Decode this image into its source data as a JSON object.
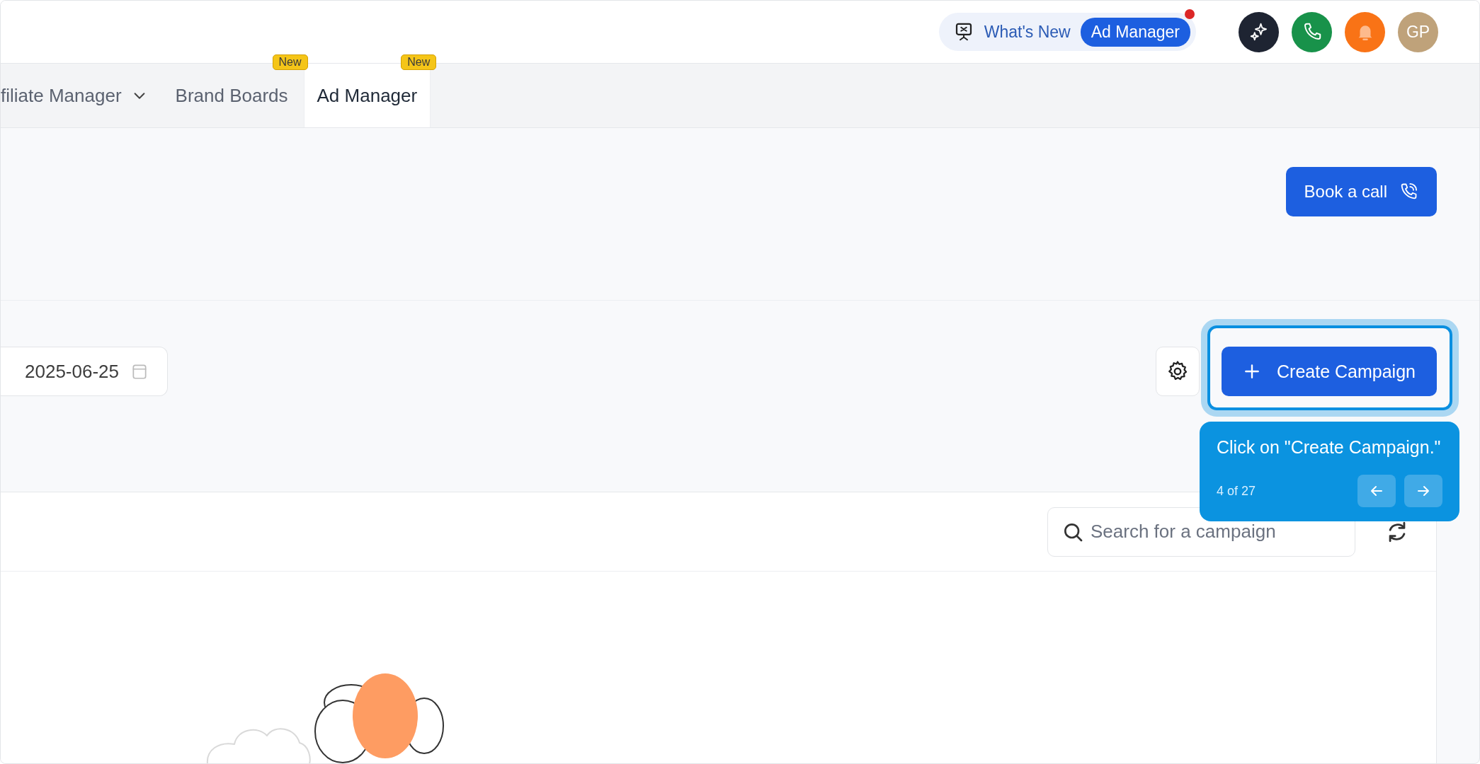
{
  "header": {
    "whats_new": {
      "label": "What's New"
    },
    "product_pill": {
      "label": "Ad Manager",
      "notification": true
    },
    "avatar": {
      "initials": "GP"
    }
  },
  "tabs": [
    {
      "label": "filiate Manager",
      "dropdown": true,
      "selected": false
    },
    {
      "label": "Brand Boards",
      "badge": "New",
      "selected": false
    },
    {
      "label": "Ad Manager",
      "badge": "New",
      "selected": true
    }
  ],
  "book_call": {
    "label": "Book a call"
  },
  "date_field": {
    "value": "2025-06-25"
  },
  "create_button": {
    "label": "Create Campaign"
  },
  "tour_tooltip": {
    "message": "Click on \"Create Campaign.\"",
    "progress": "4 of 27"
  },
  "search": {
    "placeholder": "Search for a campaign"
  }
}
